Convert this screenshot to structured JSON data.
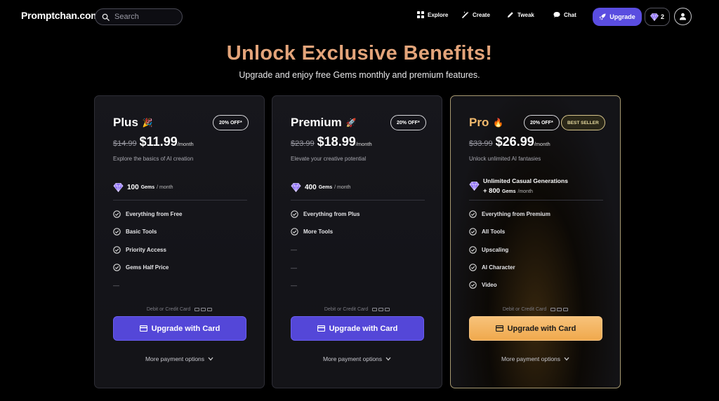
{
  "header": {
    "logo": "Promptchan.com",
    "search_placeholder": "Search",
    "nav": [
      {
        "label": "Explore",
        "icon": "grid-icon"
      },
      {
        "label": "Create",
        "icon": "wand-icon"
      },
      {
        "label": "Tweak",
        "icon": "pencil-icon"
      },
      {
        "label": "Chat",
        "icon": "chat-bubble-icon"
      }
    ],
    "upgrade_label": "Upgrade",
    "gems_count": "2"
  },
  "hero": {
    "title": "Unlock Exclusive Benefits!",
    "subtitle": "Upgrade and enjoy free Gems monthly and premium features."
  },
  "plans": [
    {
      "name": "Plus",
      "emoji": "🎉",
      "discount": "20% OFF*",
      "old_price": "$14.99",
      "price": "$11.99",
      "per": "/month",
      "description": "Explore the basics of AI creation",
      "gems_amount": "100",
      "gems_unit": "Gems",
      "gems_per": "/ month",
      "features": [
        "Everything from Free",
        "Basic Tools",
        "Priority Access",
        "Gems Half Price"
      ],
      "empty_rows": 1,
      "pay_note": "Debit or Credit Card",
      "cta": "Upgrade with Card",
      "more_payment": "More payment options"
    },
    {
      "name": "Premium",
      "emoji": "🚀",
      "discount": "20% OFF*",
      "old_price": "$23.99",
      "price": "$18.99",
      "per": "/month",
      "description": "Elevate your creative potential",
      "gems_amount": "400",
      "gems_unit": "Gems",
      "gems_per": "/ month",
      "features": [
        "Everything from Plus",
        "More Tools"
      ],
      "empty_rows": 3,
      "pay_note": "Debit or Credit Card",
      "cta": "Upgrade with Card",
      "more_payment": "More payment options"
    },
    {
      "name": "Pro",
      "emoji": "🔥",
      "discount": "20% OFF*",
      "best_seller": "BEST SELLER",
      "old_price": "$33.99",
      "price": "$26.99",
      "per": "/month",
      "description": "Unlock unlimited AI fantasies",
      "gems_line1": "Unlimited Casual Generations",
      "gems_line2_prefix": "+ 800",
      "gems_unit": "Gems",
      "gems_per": "/month",
      "features": [
        "Everything from Premium",
        "All Tools",
        "Upscaling",
        "AI Character",
        "Video"
      ],
      "empty_rows": 0,
      "pay_note": "Debit or Credit Card",
      "cta": "Upgrade with Card",
      "more_payment": "More payment options"
    }
  ],
  "colors": {
    "accent_purple": "#5447d8",
    "gold_title": "#e3a47a",
    "pro_cta": "#f0a94d",
    "background": "#000000"
  }
}
